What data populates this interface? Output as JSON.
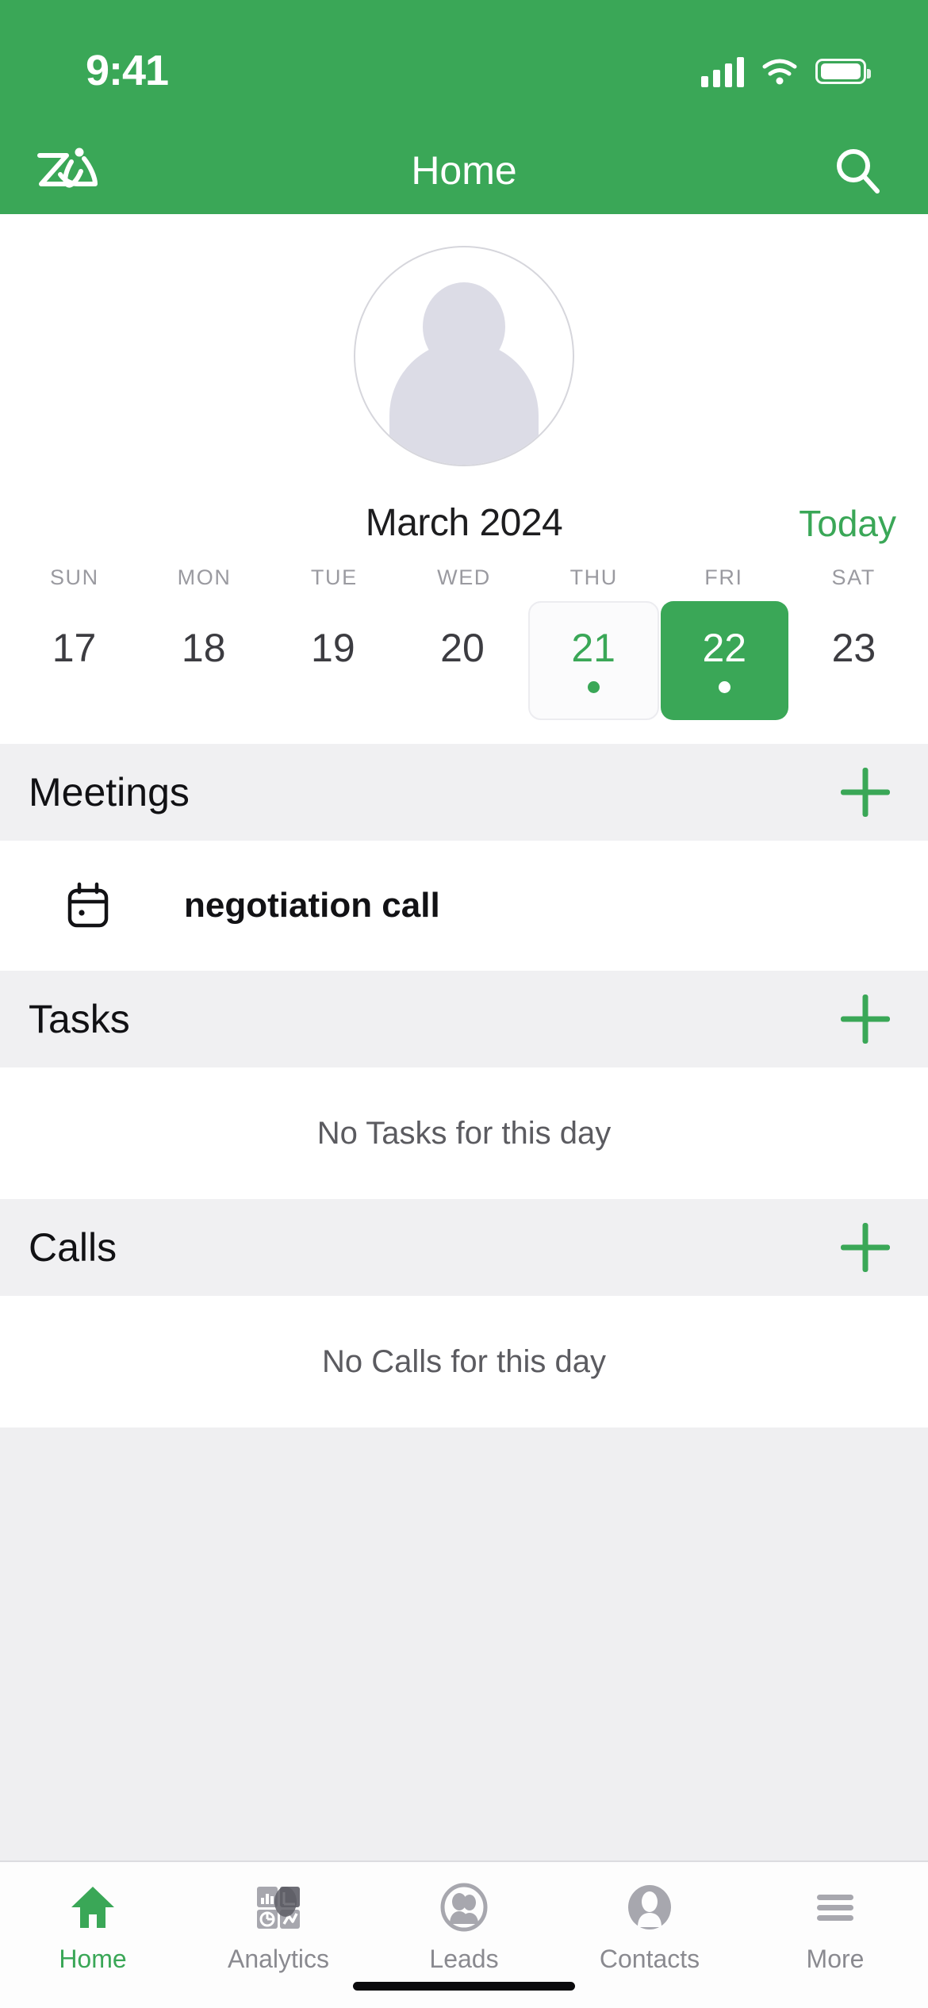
{
  "theme": {
    "accent": "#3aa757",
    "section_bg": "#f0f0f2",
    "page_bg": "#ffffff"
  },
  "status_bar": {
    "time": "9:41",
    "cellular_icon": "cellular-signal-icon",
    "wifi_icon": "wifi-icon",
    "battery_icon": "battery-icon"
  },
  "navbar": {
    "logo_icon": "zia-logo-icon",
    "title": "Home",
    "search_icon": "search-icon"
  },
  "profile": {
    "avatar_icon": "user-avatar-placeholder"
  },
  "calendar": {
    "month_label": "March 2024",
    "today_label": "Today",
    "weekdays": [
      "SUN",
      "MON",
      "TUE",
      "WED",
      "THU",
      "FRI",
      "SAT"
    ],
    "days": [
      {
        "num": "17",
        "state": "normal"
      },
      {
        "num": "18",
        "state": "normal"
      },
      {
        "num": "19",
        "state": "normal"
      },
      {
        "num": "20",
        "state": "normal"
      },
      {
        "num": "21",
        "state": "today"
      },
      {
        "num": "22",
        "state": "selected"
      },
      {
        "num": "23",
        "state": "normal"
      }
    ]
  },
  "sections": [
    {
      "title": "Meetings",
      "add_icon": "plus-icon",
      "items": [
        {
          "icon": "calendar-icon",
          "title": "negotiation call"
        }
      ],
      "empty_text": ""
    },
    {
      "title": "Tasks",
      "add_icon": "plus-icon",
      "items": [],
      "empty_text": "No Tasks for this day"
    },
    {
      "title": "Calls",
      "add_icon": "plus-icon",
      "items": [],
      "empty_text": "No Calls for this day"
    }
  ],
  "tabbar": {
    "tabs": [
      {
        "label": "Home",
        "icon": "home-icon",
        "active": true
      },
      {
        "label": "Analytics",
        "icon": "analytics-icon",
        "active": false
      },
      {
        "label": "Leads",
        "icon": "leads-icon",
        "active": false
      },
      {
        "label": "Contacts",
        "icon": "contacts-icon",
        "active": false
      },
      {
        "label": "More",
        "icon": "hamburger-menu-icon",
        "active": false
      }
    ]
  }
}
